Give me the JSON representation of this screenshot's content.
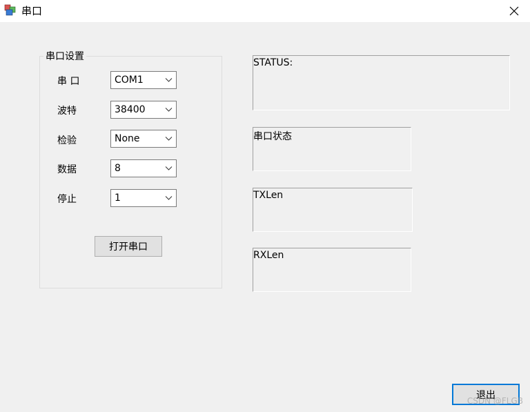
{
  "window": {
    "title": "串口",
    "close_icon": "close-icon"
  },
  "settings": {
    "group_title": "串口设置",
    "fields": [
      {
        "label": "串 口",
        "value": "COM1"
      },
      {
        "label": "波特",
        "value": "38400"
      },
      {
        "label": "检验",
        "value": "None"
      },
      {
        "label": "数据",
        "value": "8"
      },
      {
        "label": "停止",
        "value": "1"
      }
    ],
    "open_button": "打开串口"
  },
  "status_panel": {
    "status": "STATUS:",
    "port_state": "串口状态",
    "tx_len": "TXLen",
    "rx_len": "RXLen"
  },
  "footer": {
    "exit_button": "退出"
  },
  "watermark": "CSDN @FLGB",
  "colors": {
    "accent": "#0078d7",
    "window_bg": "#f0f0f0"
  }
}
